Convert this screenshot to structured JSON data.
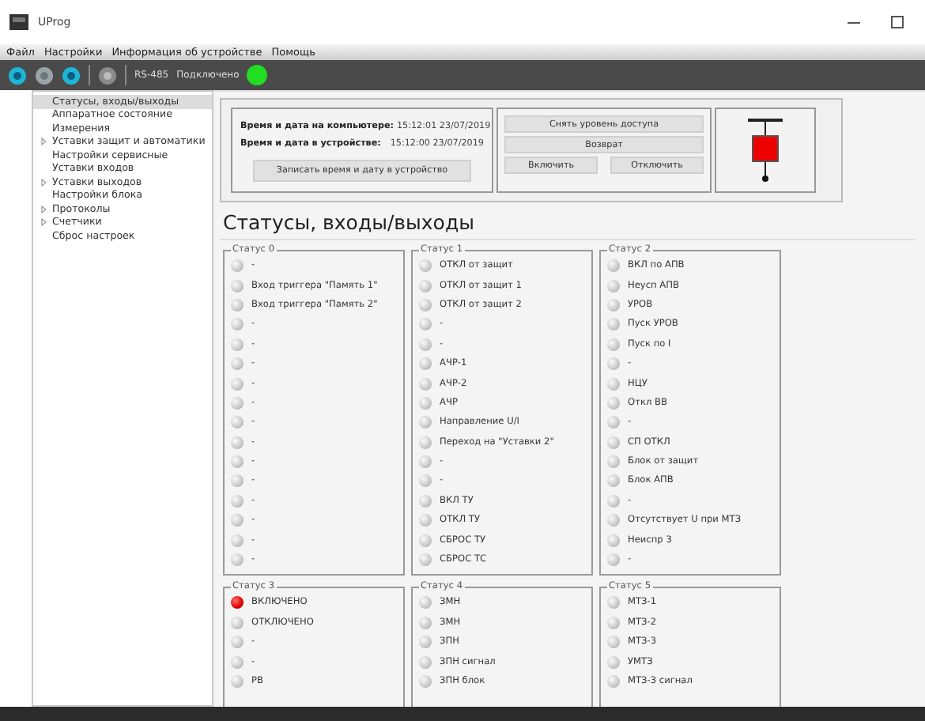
{
  "window": {
    "title": "UProg"
  },
  "menu": [
    "Файл",
    "Настройки",
    "Информация об устройстве",
    "Помощь"
  ],
  "toolbar": {
    "port": "RS-485",
    "status": "Подключено",
    "connected": true
  },
  "sidebar": {
    "items": [
      {
        "label": "Статусы, входы/выходы",
        "selected": true
      },
      {
        "label": "Аппаратное состояние",
        "selected": false
      },
      {
        "label": "Измерения",
        "selected": false
      },
      {
        "label": "Уставки защит и автоматики",
        "selected": false,
        "expanded": false
      },
      {
        "label": "Настройки сервисные",
        "selected": false
      },
      {
        "label": "Уставки входов",
        "selected": false
      },
      {
        "label": "Уставки выходов",
        "selected": false,
        "expanded": false
      },
      {
        "label": "Настройки блока",
        "selected": false
      },
      {
        "label": "Протоколы",
        "selected": false,
        "expanded": false
      },
      {
        "label": "Счетчики",
        "selected": false,
        "expanded": false
      },
      {
        "label": "Сброс настроек",
        "selected": false
      }
    ]
  },
  "clock": {
    "computer_label": "Время и дата на компьютере:",
    "computer_value": "15:12:01 23/07/2019",
    "device_label": "Время и дата в устройстве:",
    "device_value": "15:12:00 23/07/2019",
    "write_button": "Записать время и дату в устройство"
  },
  "control_buttons": {
    "release_access": "Снять уровень доступа",
    "reset": "Возврат",
    "switch_on": "Включить",
    "switch_off": "Отключить"
  },
  "breaker": {
    "closed": true
  },
  "section_title": "Статусы, входы/выходы",
  "status_groups": [
    {
      "title": "Статус 0",
      "signals": [
        {
          "label": "-",
          "on": false
        },
        {
          "label": "Вход триггера \"Память 1\"",
          "on": false
        },
        {
          "label": "Вход триггера \"Память 2\"",
          "on": false
        },
        {
          "label": "-",
          "on": false
        },
        {
          "label": "-",
          "on": false
        },
        {
          "label": "-",
          "on": false
        },
        {
          "label": "-",
          "on": false
        },
        {
          "label": "-",
          "on": false
        },
        {
          "label": "-",
          "on": false
        },
        {
          "label": "-",
          "on": false
        },
        {
          "label": "-",
          "on": false
        },
        {
          "label": "-",
          "on": false
        },
        {
          "label": "-",
          "on": false
        },
        {
          "label": "-",
          "on": false
        },
        {
          "label": "-",
          "on": false
        },
        {
          "label": "-",
          "on": false
        }
      ]
    },
    {
      "title": "Статус 1",
      "signals": [
        {
          "label": "ОТКЛ от защит",
          "on": false
        },
        {
          "label": "ОТКЛ от защит 1",
          "on": false
        },
        {
          "label": "ОТКЛ от защит 2",
          "on": false
        },
        {
          "label": "-",
          "on": false
        },
        {
          "label": "-",
          "on": false
        },
        {
          "label": "АЧР-1",
          "on": false
        },
        {
          "label": "АЧР-2",
          "on": false
        },
        {
          "label": "АЧР",
          "on": false
        },
        {
          "label": "Направление U/I",
          "on": false
        },
        {
          "label": "Переход на \"Уставки 2\"",
          "on": false
        },
        {
          "label": "-",
          "on": false
        },
        {
          "label": "-",
          "on": false
        },
        {
          "label": "ВКЛ ТУ",
          "on": false
        },
        {
          "label": "ОТКЛ ТУ",
          "on": false
        },
        {
          "label": "СБРОС ТУ",
          "on": false
        },
        {
          "label": "СБРОС ТС",
          "on": false
        }
      ]
    },
    {
      "title": "Статус 2",
      "signals": [
        {
          "label": "ВКЛ по АПВ",
          "on": false
        },
        {
          "label": "Неусп АПВ",
          "on": false
        },
        {
          "label": "УРОВ",
          "on": false
        },
        {
          "label": "Пуск УРОВ",
          "on": false
        },
        {
          "label": "Пуск по I",
          "on": false
        },
        {
          "label": "-",
          "on": false
        },
        {
          "label": "НЦУ",
          "on": false
        },
        {
          "label": "Откл ВВ",
          "on": false
        },
        {
          "label": "-",
          "on": false
        },
        {
          "label": "СП ОТКЛ",
          "on": false
        },
        {
          "label": "Блок от защит",
          "on": false
        },
        {
          "label": "Блок АПВ",
          "on": false
        },
        {
          "label": "-",
          "on": false
        },
        {
          "label": "Отсутствует U при МТЗ",
          "on": false
        },
        {
          "label": "Неиспр 3",
          "on": false
        },
        {
          "label": "-",
          "on": false
        }
      ]
    },
    {
      "title": "Статус 3",
      "signals": [
        {
          "label": "ВКЛЮЧЕНО",
          "on": true
        },
        {
          "label": "ОТКЛЮЧЕНО",
          "on": false
        },
        {
          "label": "-",
          "on": false
        },
        {
          "label": "-",
          "on": false
        },
        {
          "label": "РВ",
          "on": false
        }
      ]
    },
    {
      "title": "Статус 4",
      "signals": [
        {
          "label": "ЗМН",
          "on": false
        },
        {
          "label": "ЗМН",
          "on": false
        },
        {
          "label": "ЗПН",
          "on": false
        },
        {
          "label": "ЗПН сигнал",
          "on": false
        },
        {
          "label": "ЗПН блок",
          "on": false
        }
      ]
    },
    {
      "title": "Статус 5",
      "signals": [
        {
          "label": "МТЗ-1",
          "on": false
        },
        {
          "label": "МТЗ-2",
          "on": false
        },
        {
          "label": "МТЗ-3",
          "on": false
        },
        {
          "label": "УМТЗ",
          "on": false
        },
        {
          "label": "МТЗ-3 сигнал",
          "on": false
        }
      ]
    }
  ]
}
